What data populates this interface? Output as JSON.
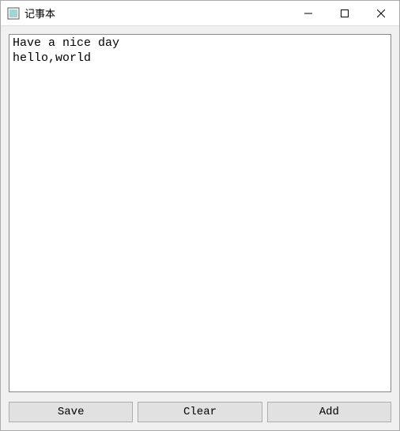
{
  "window": {
    "title": "记事本"
  },
  "editor": {
    "content": "Have a nice day\nhello,world"
  },
  "buttons": {
    "save": "Save",
    "clear": "Clear",
    "add": "Add"
  }
}
